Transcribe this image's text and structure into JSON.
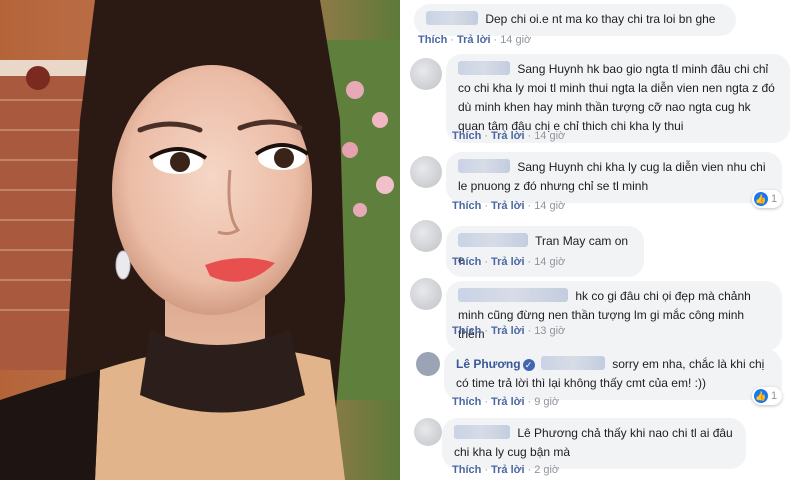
{
  "comments": [
    {
      "text": "Dep chi oi.e nt ma ko thay chi tra loi bn ghe",
      "like": "Thích",
      "reply": "Trả lời",
      "time": "14 giờ"
    },
    {
      "text": "Sang Huynh hk bao gio ngta tl minh đâu chi chỉ co chi kha ly moi tl minh thui ngta la diễn vien nen ngta z đó dù minh khen hay minh thần tượng cỡ nao ngta cug hk quan tâm đâu chị e chỉ thich chi kha ly thui",
      "like": "Thích",
      "reply": "Trả lời",
      "time": "14 giờ"
    },
    {
      "text": "Sang Huynh chi kha ly cug la diễn vien nhu chi le pnuong z đó nhưng chỉ se tl minh",
      "like": "Thích",
      "reply": "Trả lời",
      "time": "14 giờ",
      "reaction_count": "1"
    },
    {
      "text": "Tran May cam on e",
      "like": "Thích",
      "reply": "Trả lời",
      "time": "14 giờ"
    },
    {
      "text": "hk co gi đâu chi ọi đẹp mà chảnh minh cũng đừng nen thần tượng lm gi mắc công minh thêm",
      "like": "Thích",
      "reply": "Trả lời",
      "time": "13 giờ"
    },
    {
      "author": "Lê Phương",
      "text": "sorry em nha, chắc là khi chị có time trả lời thì lại không thấy cmt của em! :))",
      "like": "Thích",
      "reply": "Trả lời",
      "time": "9 giờ",
      "reaction_count": "1"
    },
    {
      "text": "Lê Phương chả thấy khi nao chi tl ai đâu chi kha ly cug bận mà",
      "like": "Thích",
      "reply": "Trả lời",
      "time": "2 giờ"
    }
  ]
}
